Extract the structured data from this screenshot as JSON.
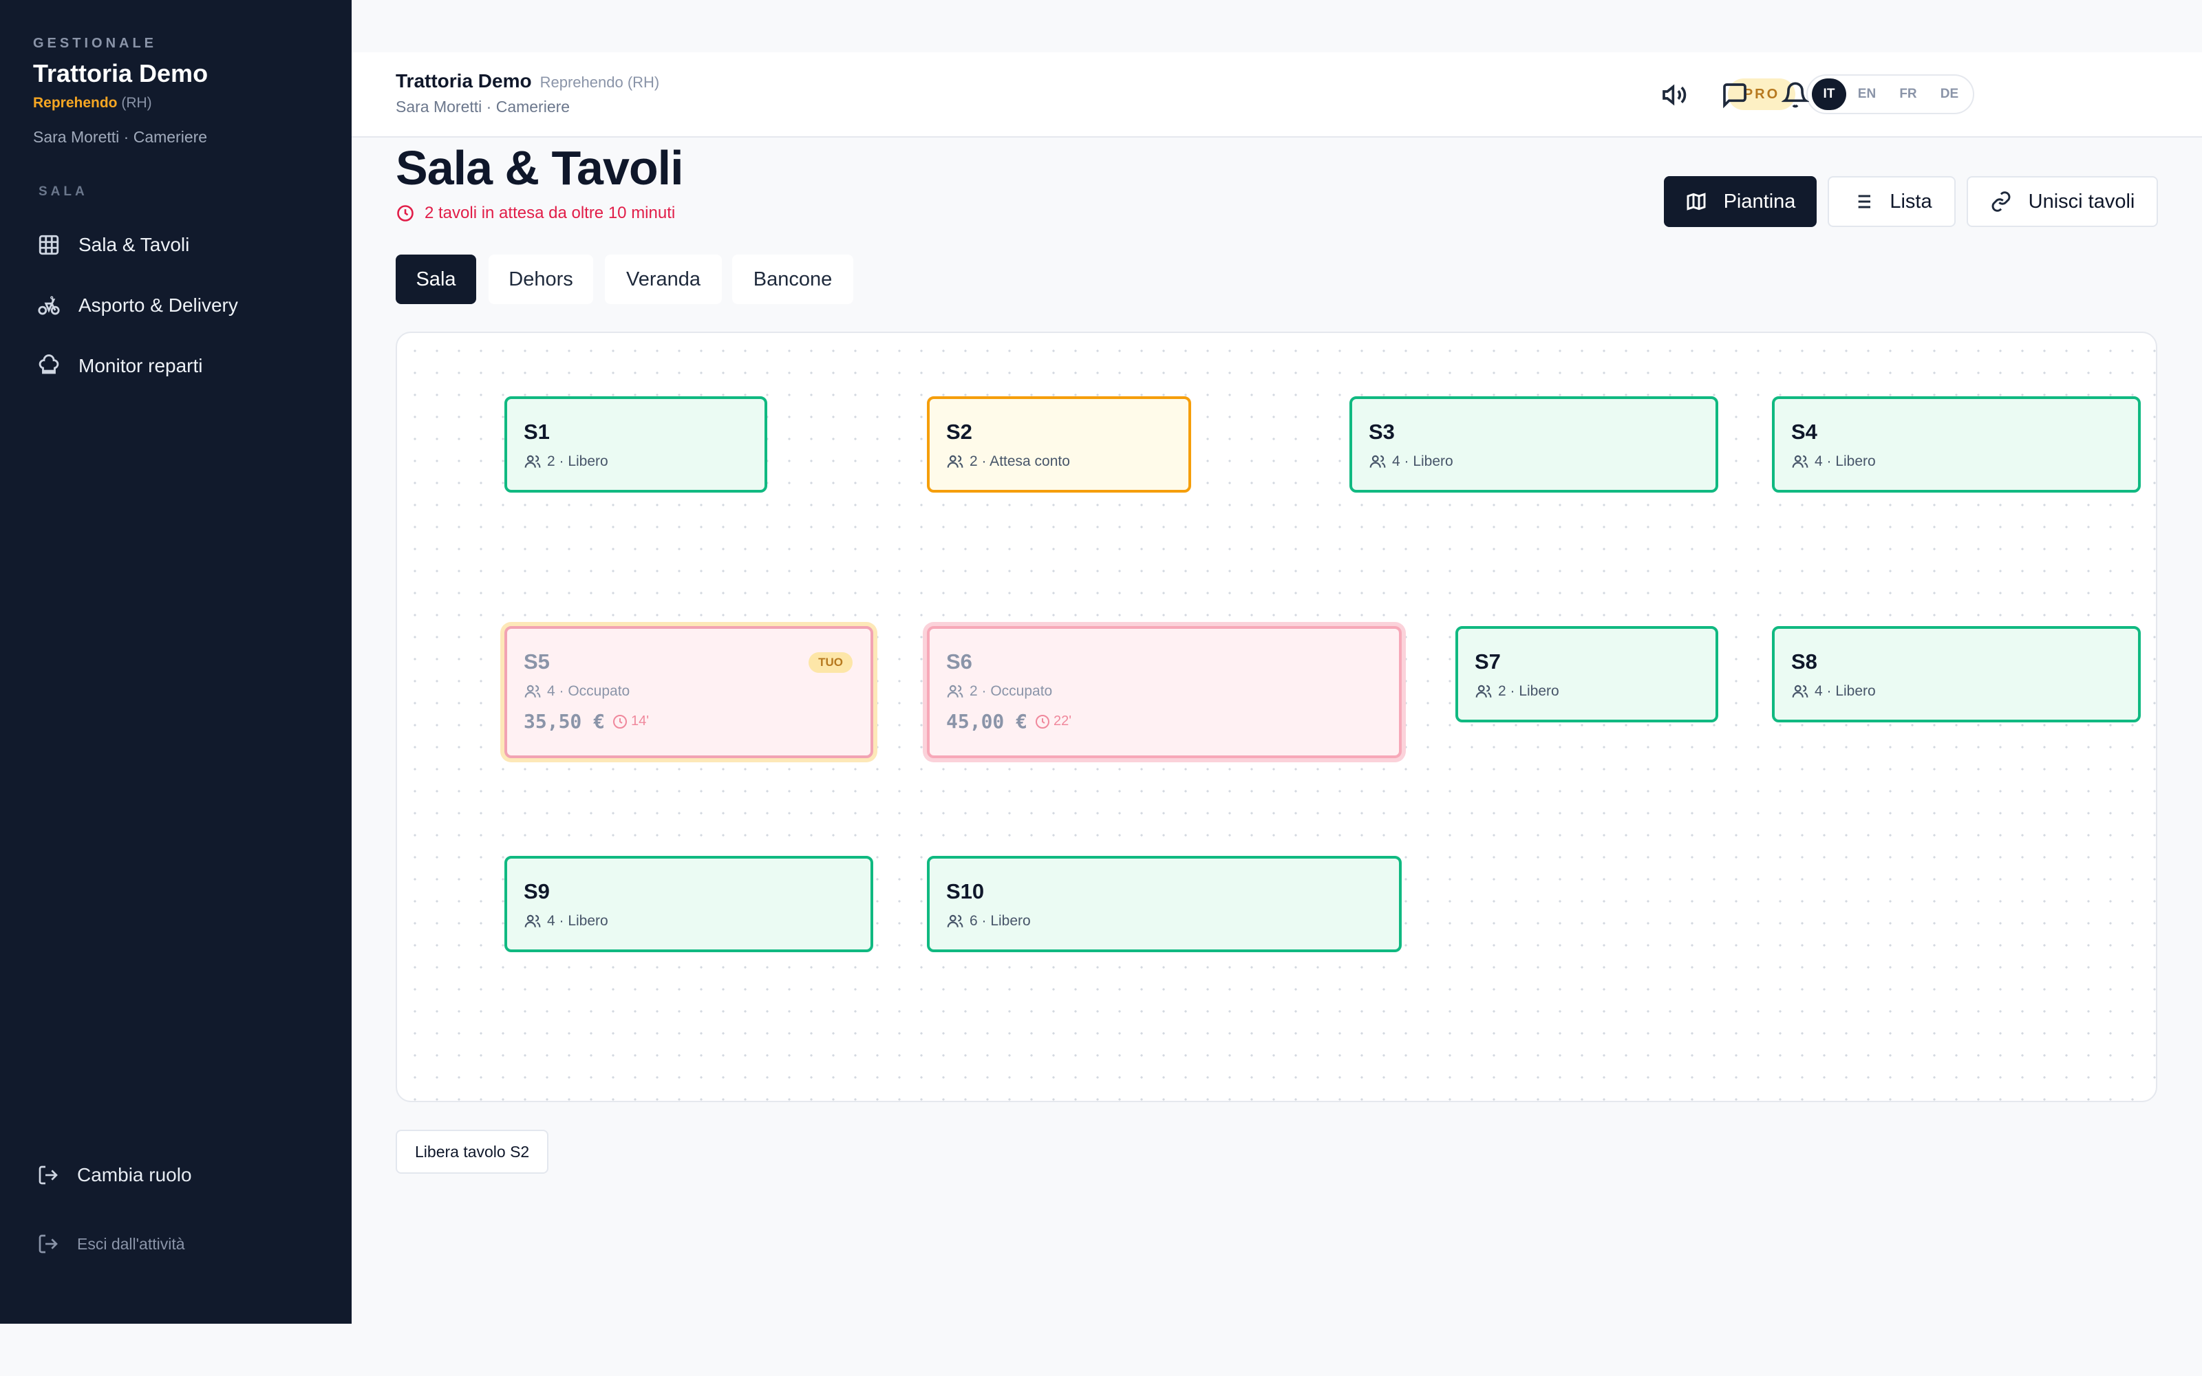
{
  "sidebar": {
    "kicker": "GESTIONALE",
    "title": "Trattoria Demo",
    "branch_name": "Reprehendo",
    "branch_code": "(RH)",
    "user": "Sara Moretti · Cameriere",
    "section": "SALA",
    "items": [
      {
        "label": "Sala & Tavoli",
        "icon": "grid-icon"
      },
      {
        "label": "Asporto & Delivery",
        "icon": "bike-icon"
      },
      {
        "label": "Monitor reparti",
        "icon": "chef-hat-icon"
      }
    ],
    "change_role": "Cambia ruolo",
    "exit": "Esci dall'attività"
  },
  "header": {
    "title": "Trattoria Demo",
    "branch": "Reprehendo (RH)",
    "user": "Sara Moretti · Cameriere",
    "plan_badge": "PRO",
    "languages": [
      "IT",
      "EN",
      "FR",
      "DE"
    ],
    "active_language": "IT"
  },
  "page": {
    "title": "Sala & Tavoli",
    "alert": "2 tavoli in attesa da oltre 10 minuti",
    "views": {
      "map": "Piantina",
      "list": "Lista",
      "merge": "Unisci tavoli"
    },
    "tabs": [
      "Sala",
      "Dehors",
      "Veranda",
      "Bancone"
    ],
    "active_tab": "Sala",
    "free_button": "Libera tavolo S2"
  },
  "tables": [
    {
      "id": "S1",
      "meta": "2 · Libero",
      "status": "free"
    },
    {
      "id": "S2",
      "meta": "2 · Attesa conto",
      "status": "waiting"
    },
    {
      "id": "S3",
      "meta": "4 · Libero",
      "status": "free"
    },
    {
      "id": "S4",
      "meta": "4 · Libero",
      "status": "free"
    },
    {
      "id": "S5",
      "meta": "4 · Occupato",
      "status": "occupied",
      "amount": "35,50 €",
      "timer": "14'",
      "badge": "TUO"
    },
    {
      "id": "S6",
      "meta": "2 · Occupato",
      "status": "occupied",
      "amount": "45,00 €",
      "timer": "22'"
    },
    {
      "id": "S7",
      "meta": "2 · Libero",
      "status": "free"
    },
    {
      "id": "S8",
      "meta": "4 · Libero",
      "status": "free"
    },
    {
      "id": "S9",
      "meta": "4 · Libero",
      "status": "free"
    },
    {
      "id": "S10",
      "meta": "6 · Libero",
      "status": "free"
    }
  ],
  "colors": {
    "sidebar_bg": "#111a2c",
    "free": "#10b981",
    "waiting": "#f59e0b",
    "occupied": "#f2a3b3",
    "alert": "#e11d48",
    "accent": "#f5a623"
  }
}
